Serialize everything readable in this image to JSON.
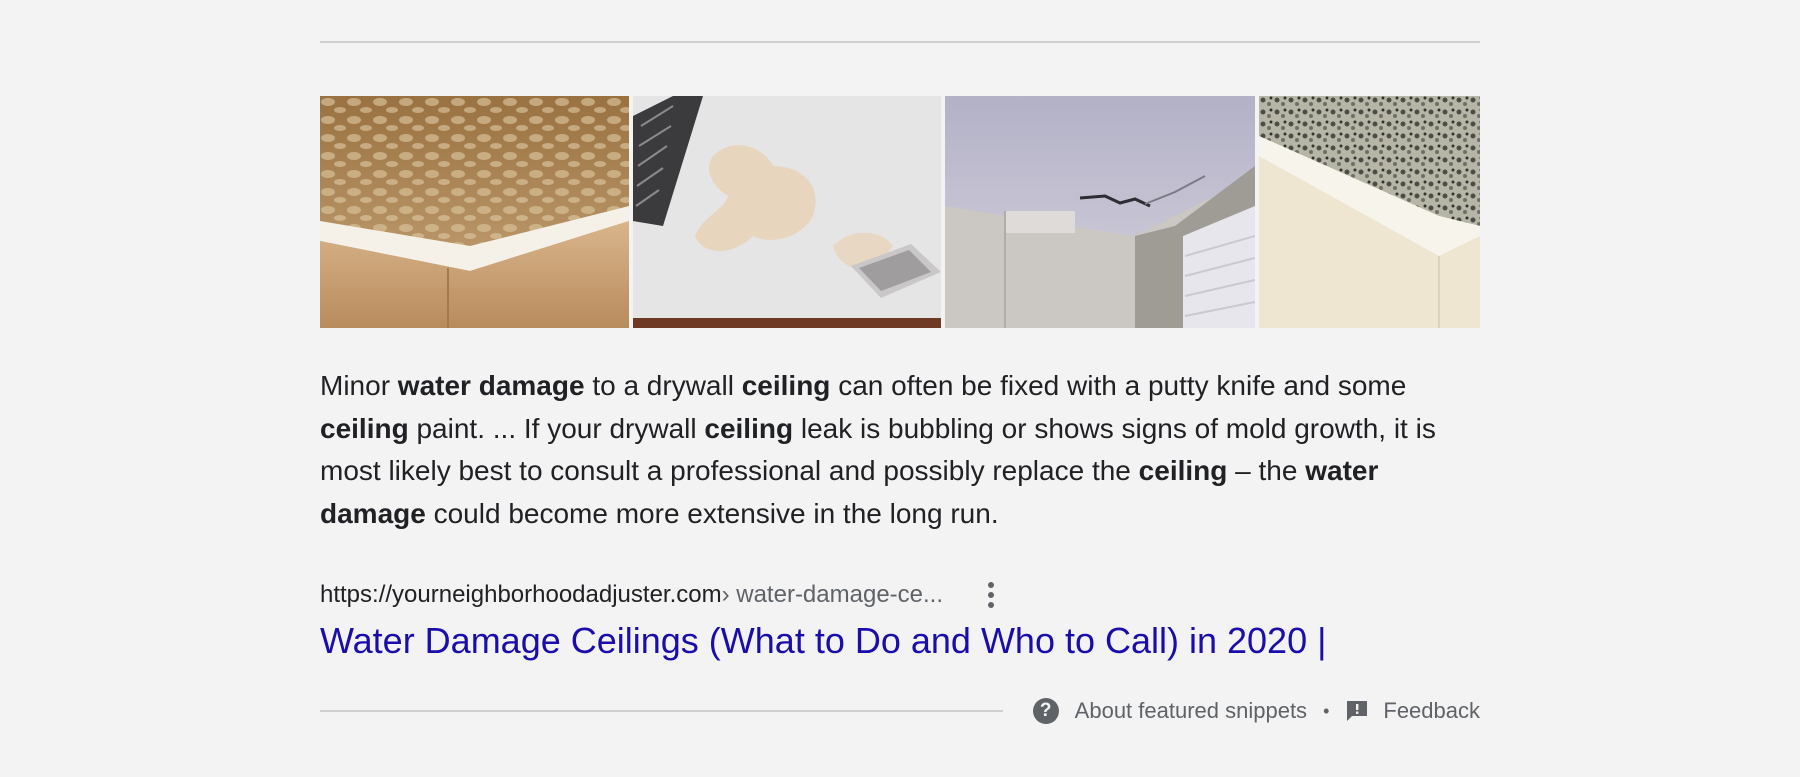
{
  "images": [
    {
      "alt": "stained ceiling corner",
      "icon": "ceiling-water-stain-image"
    },
    {
      "alt": "water stain on white ceiling near vent",
      "icon": "ceiling-leak-image"
    },
    {
      "alt": "cracked ceiling near window",
      "icon": "ceiling-crack-image"
    },
    {
      "alt": "mold on ceiling corner",
      "icon": "ceiling-mold-image"
    }
  ],
  "snippet": {
    "parts": [
      {
        "text": "Minor ",
        "bold": false
      },
      {
        "text": "water damage",
        "bold": true
      },
      {
        "text": " to a drywall ",
        "bold": false
      },
      {
        "text": "ceiling",
        "bold": true
      },
      {
        "text": " can often be fixed with a putty knife and some ",
        "bold": false
      },
      {
        "text": "ceiling",
        "bold": true
      },
      {
        "text": " paint. ... If your drywall ",
        "bold": false
      },
      {
        "text": "ceiling",
        "bold": true
      },
      {
        "text": " leak is bubbling or shows signs of mold growth, it is most likely best to consult a professional and possibly replace the ",
        "bold": false
      },
      {
        "text": "ceiling",
        "bold": true
      },
      {
        "text": " – the ",
        "bold": false
      },
      {
        "text": "water damage",
        "bold": true
      },
      {
        "text": " could become more extensive in the long run.",
        "bold": false
      }
    ]
  },
  "result": {
    "url_domain": "https://yourneighborhoodadjuster.com",
    "url_path": " › water-damage-ce...",
    "title": "Water Damage Ceilings (What to Do and Who to Call) in 2020 |"
  },
  "footer": {
    "about_label": "About featured snippets",
    "separator": "•",
    "feedback_label": "Feedback",
    "about_icon": "help-circle-icon",
    "feedback_icon": "feedback-icon"
  },
  "colors": {
    "background": "#f3f3f3",
    "link": "#1a0dab",
    "text": "#202124",
    "secondary": "#5f6368"
  }
}
